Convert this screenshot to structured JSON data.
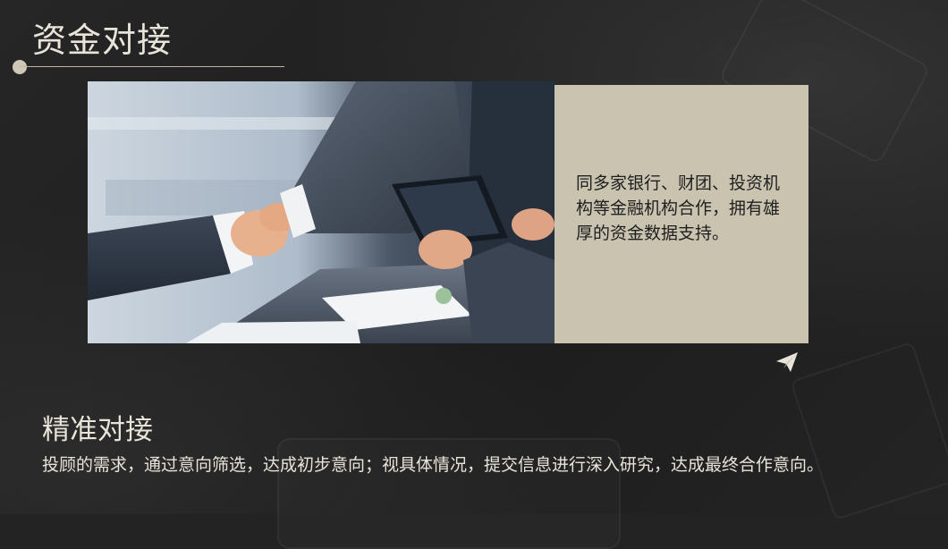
{
  "slide": {
    "title": "资金对接",
    "info_text": "同多家银行、财团、投资机构等金融机构合作，拥有雄厚的资金数据支持。",
    "section_heading": "精准对接",
    "section_body": "投顾的需求，通过意向筛选，达成初步意向；视具体情况，提交信息进行深入研究，达成最终合作意向。"
  },
  "icons": {
    "decoration": "paper-plane-icon",
    "photo": "handshake-photo"
  },
  "colors": {
    "background": "#232323",
    "info_box": "#c9c3b0",
    "text_light": "#e8e4da",
    "accent_line": "#bdb7a6"
  }
}
